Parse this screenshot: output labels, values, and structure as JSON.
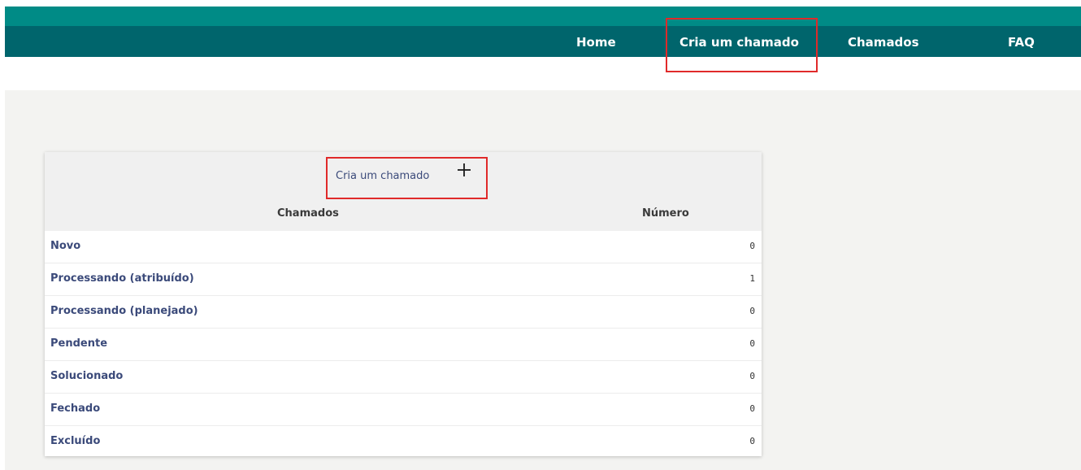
{
  "nav": {
    "items": [
      {
        "label": "Home"
      },
      {
        "label": "Cria um chamado"
      },
      {
        "label": "Chamados"
      },
      {
        "label": "FAQ"
      }
    ]
  },
  "panel": {
    "create_link": "Cria um chamado",
    "plus_icon": "plus-icon",
    "columns": {
      "chamados": "Chamados",
      "numero": "Número"
    },
    "rows": [
      {
        "label": "Novo",
        "count": "0"
      },
      {
        "label": "Processando (atribuído)",
        "count": "1"
      },
      {
        "label": "Processando (planejado)",
        "count": "0"
      },
      {
        "label": "Pendente",
        "count": "0"
      },
      {
        "label": "Solucionado",
        "count": "0"
      },
      {
        "label": "Fechado",
        "count": "0"
      },
      {
        "label": "Excluído",
        "count": "0"
      }
    ]
  },
  "colors": {
    "topbar": "#008b86",
    "navbar": "#00656c",
    "link": "#3b4a7a",
    "highlight": "#e02a2a"
  }
}
